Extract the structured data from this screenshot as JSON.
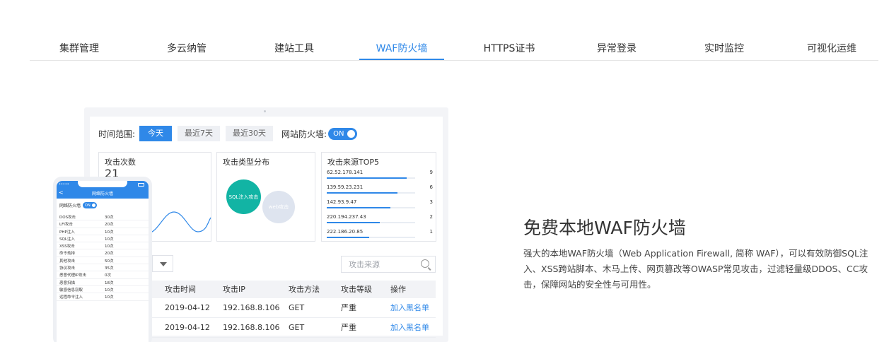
{
  "nav": {
    "tabs": [
      {
        "label": "集群管理"
      },
      {
        "label": "多云纳管"
      },
      {
        "label": "建站工具"
      },
      {
        "label": "WAF防火墙",
        "active": true
      },
      {
        "label": "HTTPS证书"
      },
      {
        "label": "异常登录"
      },
      {
        "label": "实时监控"
      },
      {
        "label": "可视化运维"
      }
    ]
  },
  "dashboard": {
    "time_range_label": "时间范围:",
    "range_options": [
      "今天",
      "最近7天",
      "最近30天"
    ],
    "firewall_label": "网站防火墙:",
    "firewall_toggle": "ON",
    "attack_count_title": "攻击次数",
    "attack_count_value": "21",
    "type_dist_title": "攻击类型分布",
    "type_bubbles": [
      "SQL注入攻击",
      "web攻击"
    ],
    "top5_title": "攻击来源TOP5",
    "top5": [
      {
        "ip": "62.52.178.141",
        "count": "9",
        "ratio": 0.9
      },
      {
        "ip": "139.59.23.231",
        "count": "6",
        "ratio": 0.8
      },
      {
        "ip": "142.93.9.47",
        "count": "3",
        "ratio": 0.72
      },
      {
        "ip": "220.194.237.43",
        "count": "2",
        "ratio": 0.6
      },
      {
        "ip": "222.186.20.85",
        "count": "1",
        "ratio": 0.48
      }
    ],
    "search_placeholder": "攻击来源",
    "table": {
      "headers": [
        "攻击时间",
        "攻击IP",
        "攻击方法",
        "攻击等级",
        "操作"
      ],
      "rows": [
        {
          "time": "2019-04-12",
          "ip": "192.168.8.106",
          "method": "GET",
          "level": "严重",
          "action": "加入黑名单"
        },
        {
          "time": "2019-04-12",
          "ip": "192.168.8.106",
          "method": "GET",
          "level": "严重",
          "action": "加入黑名单"
        }
      ]
    }
  },
  "phone": {
    "status": "•••••  ",
    "back": "<",
    "title": "网络防火墙",
    "fw_label": "网络防火墙",
    "fw_toggle": "ON",
    "items": [
      {
        "name": "DOS攻击",
        "count": "30次"
      },
      {
        "name": "LFI攻击",
        "count": "20次"
      },
      {
        "name": "PHP注入",
        "count": "10次"
      },
      {
        "name": "SQL注入",
        "count": "10次"
      },
      {
        "name": "XSS攻击",
        "count": "10次"
      },
      {
        "name": "命令劫持",
        "count": "20次"
      },
      {
        "name": "其他攻击",
        "count": "50次"
      },
      {
        "name": "协议攻击",
        "count": "35次"
      },
      {
        "name": "恶意代理IP攻击",
        "count": "0次"
      },
      {
        "name": "恶意扫描",
        "count": "18次"
      },
      {
        "name": "敏感信息窃取",
        "count": "10次"
      },
      {
        "name": "远程命令注入",
        "count": "10次"
      }
    ]
  },
  "feature": {
    "title": "免费本地WAF防火墙",
    "description": "强大的本地WAF防火墙（Web Application Firewall, 简称 WAF），可以有效防御SQL注入、XSS跨站脚本、木马上传、网页篡改等OWASP常见攻击，过滤轻量级DDOS、CC攻击，保障网站的安全性与可用性。"
  },
  "colors": {
    "accent": "#2f88e8",
    "teal": "#12b4a4"
  }
}
